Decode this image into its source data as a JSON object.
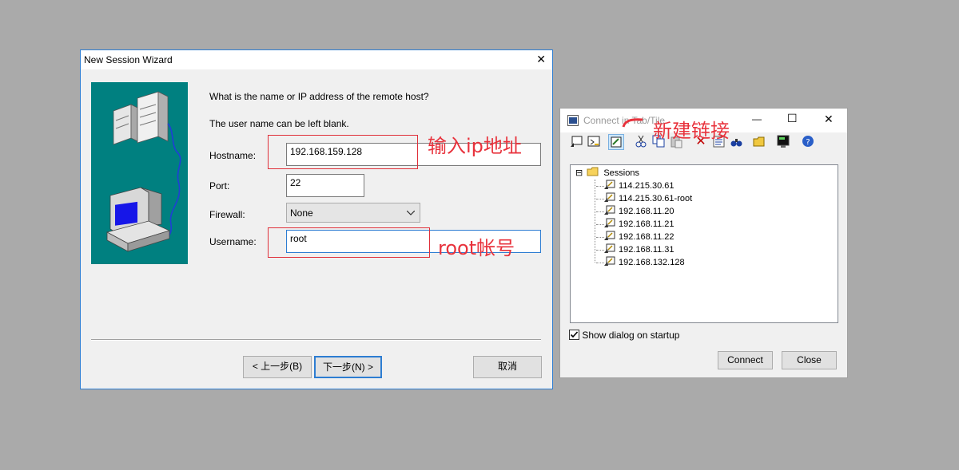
{
  "wizard": {
    "title": "New Session Wizard",
    "close_glyph": "✕",
    "intro1": "What is the name or IP address of the remote host?",
    "intro2": "The user name can be left blank.",
    "hostname_label": "Hostname:",
    "hostname_value": "192.168.159.128",
    "port_label": "Port:",
    "port_value": "22",
    "firewall_label": "Firewall:",
    "firewall_value": "None",
    "username_label": "Username:",
    "username_value": "root",
    "back_button": "< 上一步(B)",
    "next_button": "下一步(N) >",
    "cancel_button": "取消",
    "accent_color": "#2d7dd2",
    "illustration_bg": "#008080"
  },
  "connect": {
    "title": "Connect in Tab/Tile",
    "minimize_glyph": "—",
    "maximize_glyph": "☐",
    "close_glyph": "✕",
    "toolbar_icons": [
      "quick-connect-icon",
      "connect-in-tab-icon",
      "new-session-icon",
      "cut-icon",
      "copy-icon",
      "paste-icon",
      "delete-icon",
      "properties-icon",
      "find-icon",
      "new-folder-icon",
      "terminal-icon",
      "help-icon"
    ],
    "tree_root": "Sessions",
    "tree_expander": "⊟",
    "sessions": [
      "114.215.30.61",
      "114.215.30.61-root",
      "192.168.11.20",
      "192.168.11.21",
      "192.168.11.22",
      "192.168.11.31",
      "192.168.132.128"
    ],
    "show_dialog_label": "Show dialog on startup",
    "show_dialog_checked": true,
    "connect_button": "Connect",
    "close_button": "Close"
  },
  "annotations": {
    "ip_note": "输入ip地址",
    "root_note": "root帐号",
    "new_link_note": "新建链接",
    "color": "#e8323c"
  }
}
